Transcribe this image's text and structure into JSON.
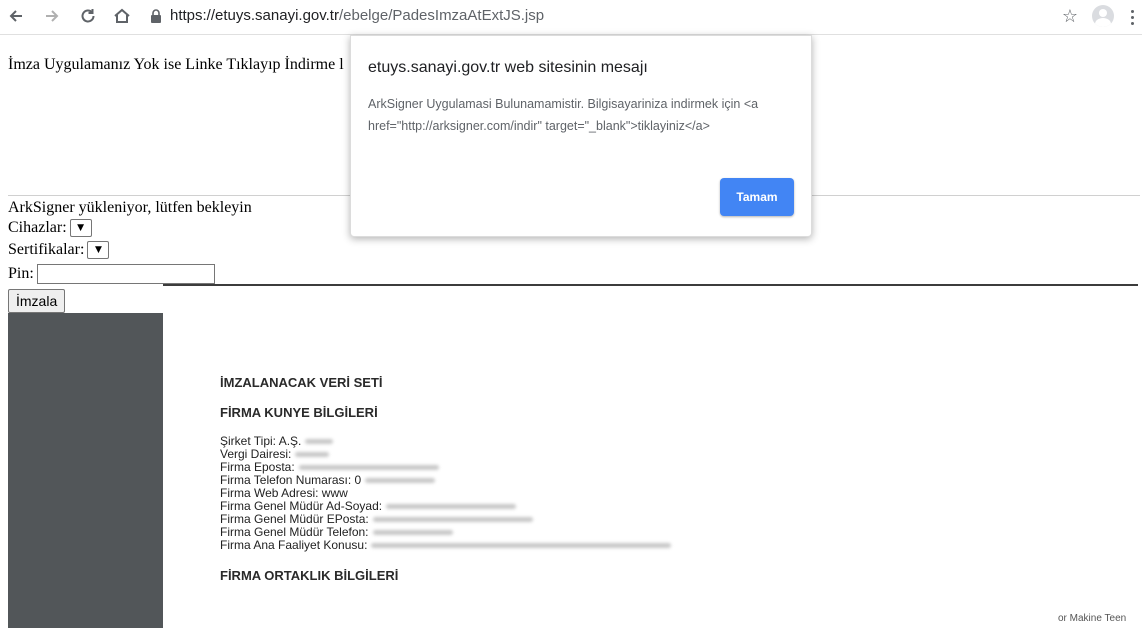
{
  "browser": {
    "url_domain": "https://etuys.sanayi.gov.tr",
    "url_path": "/ebelge/PadesImzaAtExtJS.jsp",
    "icons": [
      "back-arrow-icon",
      "forward-arrow-icon",
      "reload-icon",
      "home-icon",
      "lock-icon",
      "star-icon",
      "profile-icon",
      "kebab-menu-icon"
    ]
  },
  "page": {
    "hint_text": "İmza Uygulamanız Yok ise Linke Tıklayıp İndirme l",
    "loading_text": "ArkSigner yükleniyor, lütfen bekleyin",
    "devices_label": "Cihazlar:",
    "certificates_label": "Sertifikalar:",
    "pin_label": "Pin:",
    "pin_value": "",
    "sign_button": "İmzala"
  },
  "pdf": {
    "heading_dataset": "İMZALANACAK VERİ SETİ",
    "heading_company": "FİRMA KUNYE BİLGİLERİ",
    "fields": [
      {
        "label": "Şirket Tipi: A.Ş."
      },
      {
        "label": "Vergi Dairesi:"
      },
      {
        "label": "Firma Eposta:"
      },
      {
        "label": "Firma Telefon Numarası: 0"
      },
      {
        "label": "Firma Web Adresi: www"
      },
      {
        "label": "Firma Genel Müdür Ad-Soyad:"
      },
      {
        "label": "Firma Genel Müdür EPosta:"
      },
      {
        "label": "Firma Genel Müdür Telefon:"
      },
      {
        "label": "Firma Ana Faaliyet Konusu:"
      }
    ],
    "heading_partners": "FİRMA ORTAKLIK BİLGİLERİ",
    "corner_text": "or Makine Teen"
  },
  "dialog": {
    "title": "etuys.sanayi.gov.tr web sitesinin mesajı",
    "message": "ArkSigner Uygulamasi Bulunamamistir. Bilgisayariniza indirmek için <a href=\"http://arksigner.com/indir\" target=\"_blank\">tiklayiniz</a>",
    "ok_button": "Tamam",
    "ok_color": "#4285f4"
  }
}
